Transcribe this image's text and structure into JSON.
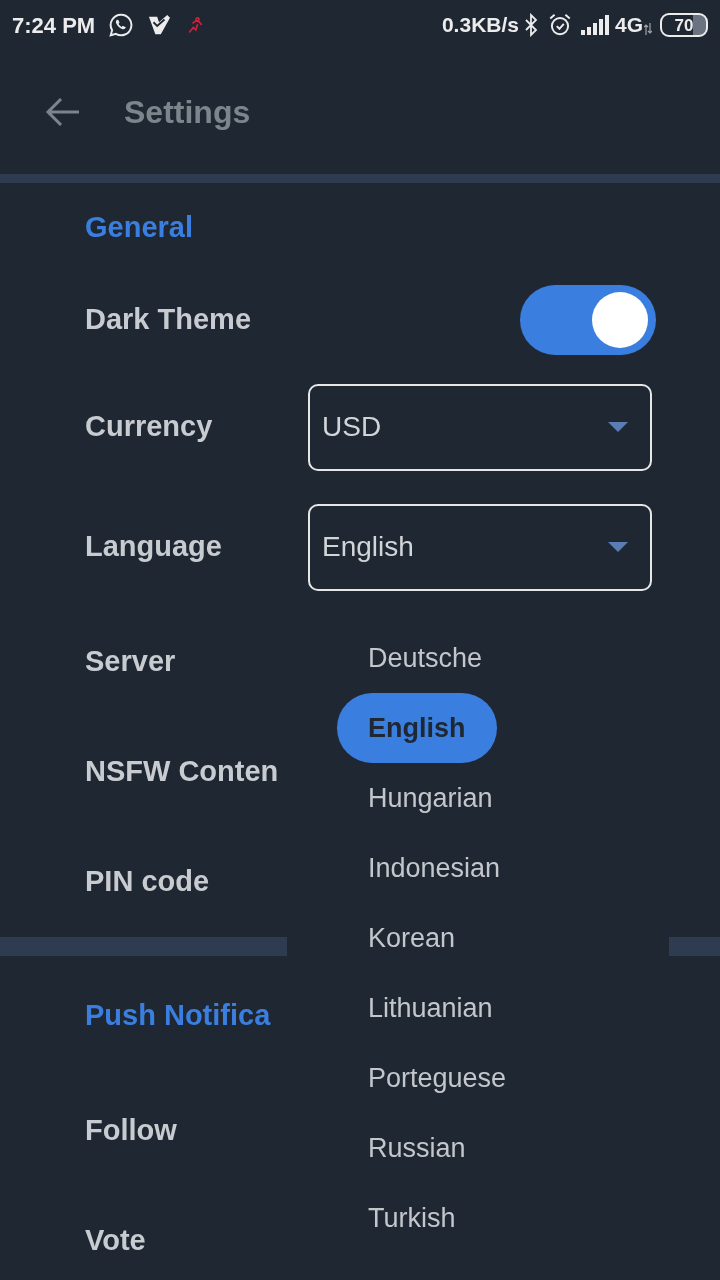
{
  "status_bar": {
    "time": "7:24 PM",
    "net_speed": "0.3KB/s",
    "network": "4G",
    "battery": "70"
  },
  "app_bar": {
    "title": "Settings"
  },
  "sections": [
    {
      "title": "General",
      "items": [
        {
          "kind": "toggle",
          "label": "Dark Theme",
          "on": true
        },
        {
          "kind": "select",
          "label": "Currency",
          "value": "USD"
        },
        {
          "kind": "select",
          "label": "Language",
          "value": "English"
        },
        {
          "kind": "plain",
          "label": "Server"
        },
        {
          "kind": "plain",
          "label": "NSFW Conten"
        },
        {
          "kind": "plain",
          "label": "PIN code"
        }
      ]
    },
    {
      "title": "Push Notifica",
      "items": [
        {
          "kind": "plain",
          "label": "Follow"
        },
        {
          "kind": "plain",
          "label": "Vote"
        }
      ]
    }
  ],
  "language_menu": {
    "options": [
      {
        "label": "Deutsche",
        "selected": false
      },
      {
        "label": "English",
        "selected": true
      },
      {
        "label": "Hungarian",
        "selected": false
      },
      {
        "label": "Indonesian",
        "selected": false
      },
      {
        "label": "Korean",
        "selected": false
      },
      {
        "label": "Lithuanian",
        "selected": false
      },
      {
        "label": "Porteguese",
        "selected": false
      },
      {
        "label": "Russian",
        "selected": false
      },
      {
        "label": "Turkish",
        "selected": false
      }
    ]
  }
}
